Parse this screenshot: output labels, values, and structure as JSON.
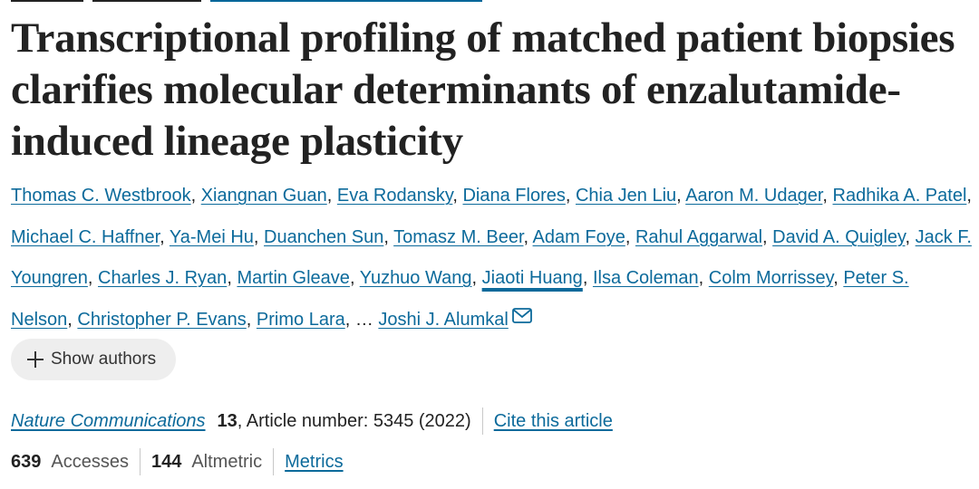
{
  "article": {
    "title": "Transcriptional profiling of matched patient biopsies clarifies molecular determinants of enzalutamide-induced lineage plasticity"
  },
  "authors": [
    {
      "name": "Thomas C. Westbrook",
      "sep": ", "
    },
    {
      "name": "Xiangnan Guan",
      "sep": ", "
    },
    {
      "name": "Eva Rodansky",
      "sep": ", "
    },
    {
      "name": "Diana Flores",
      "sep": ", "
    },
    {
      "name": "Chia Jen Liu",
      "sep": ", "
    },
    {
      "name": "Aaron M. Udager",
      "sep": ", "
    },
    {
      "name": "Radhika A. Patel",
      "sep": ", "
    },
    {
      "name": "Michael C. Haffner",
      "sep": ", "
    },
    {
      "name": "Ya-Mei Hu",
      "sep": ", "
    },
    {
      "name": "Duanchen Sun",
      "sep": ", "
    },
    {
      "name": "Tomasz M. Beer",
      "sep": ", "
    },
    {
      "name": "Adam Foye",
      "sep": ", "
    },
    {
      "name": "Rahul Aggarwal",
      "sep": ", "
    },
    {
      "name": "David A. Quigley",
      "sep": ", "
    },
    {
      "name": "Jack F. Youngren",
      "sep": ", "
    },
    {
      "name": "Charles J. Ryan",
      "sep": ", "
    },
    {
      "name": "Martin Gleave",
      "sep": ", "
    },
    {
      "name": "Yuzhuo Wang",
      "sep": ", "
    },
    {
      "name": "Jiaoti Huang",
      "sep": ", ",
      "focused": true
    },
    {
      "name": "Ilsa Coleman",
      "sep": ", "
    },
    {
      "name": "Colm Morrissey",
      "sep": ", "
    },
    {
      "name": "Peter S. Nelson",
      "sep": ", "
    },
    {
      "name": "Christopher P. Evans",
      "sep": ", "
    },
    {
      "name": "Primo Lara",
      "sep": ", … "
    },
    {
      "name": "Joshi J. Alumkal",
      "sep": "",
      "corresponding": true
    }
  ],
  "show_authors_label": "Show authors",
  "citation": {
    "journal": "Nature Communications",
    "volume": "13",
    "article_text": ", Article number: 5345 (2022)",
    "cite_link": "Cite this article"
  },
  "metrics": {
    "accesses_count": "639",
    "accesses_label": "Accesses",
    "altmetric_count": "144",
    "altmetric_label": "Altmetric",
    "metrics_link": "Metrics"
  },
  "icons": {
    "email": "envelope-icon",
    "expand": "plus-icon"
  },
  "colors": {
    "link": "#0c6a9b",
    "text": "#222222",
    "pill_bg": "#eeeeee"
  }
}
